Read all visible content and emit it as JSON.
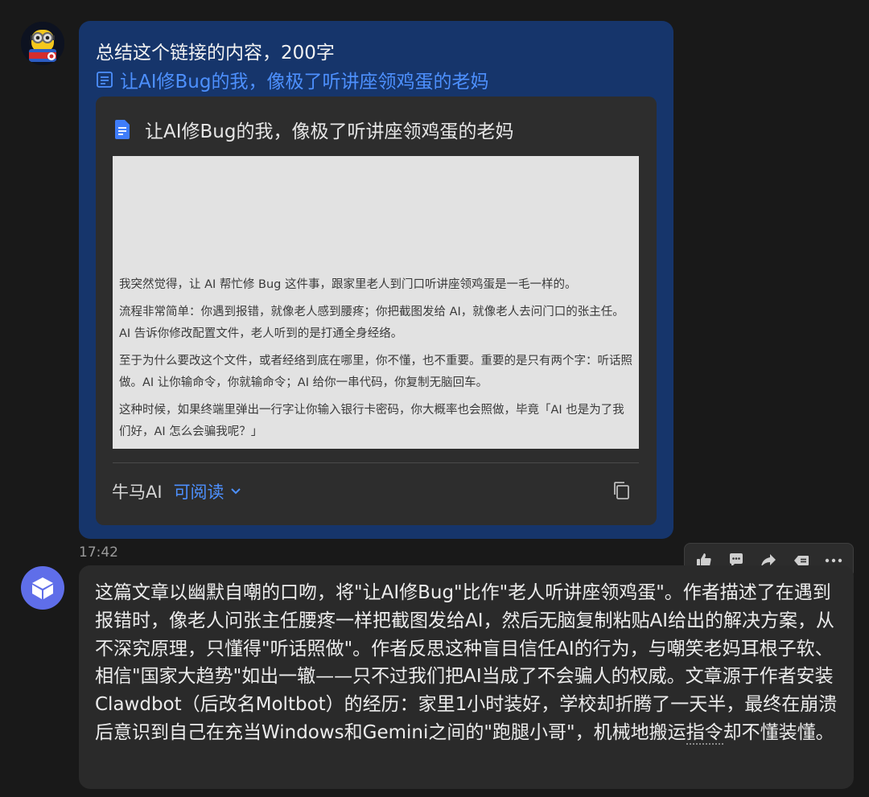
{
  "user_message": {
    "text": "总结这个链接的内容，200字",
    "link_text": "让AI修Bug的我，像极了听讲座领鸡蛋的老妈",
    "link_card": {
      "title": "让AI修Bug的我，像极了听讲座领鸡蛋的老妈",
      "preview_paragraphs": [
        "我突然觉得，让 AI 帮忙修 Bug 这件事，跟家里老人到门口听讲座领鸡蛋是一毛一样的。",
        "流程非常简单：你遇到报错，就像老人感到腰疼；你把截图发给 AI，就像老人去问门口的张主任。AI 告诉你修改配置文件，老人听到的是打通全身经络。",
        "至于为什么要改这个文件，或者经络到底在哪里，你不懂，也不重要。重要的是只有两个字：听话照做。AI 让你输命令，你就输命令；AI 给你一串代码，你复制无脑回车。",
        "这种时候，如果终端里弹出一行字让你输入银行卡密码，你大概率也会照做，毕竟「AI 也是为了我们好，AI 怎么会骗我呢？」"
      ],
      "source": "牛马AI",
      "readable_label": "可阅读",
      "doc_icon": "document-icon",
      "copy_icon": "copy-icon"
    },
    "timestamp": "17:42"
  },
  "toolbar": {
    "icons": [
      "thumbs-up-icon",
      "comment-icon",
      "share-icon",
      "quote-icon",
      "more-icon"
    ]
  },
  "ai_message": {
    "text_main": "这篇文章以幽默自嘲的口吻，将\"让AI修Bug\"比作\"老人听讲座领鸡蛋\"。作者描述了在遇到报错时，像老人问张主任腰疼一样把截图发给AI，然后无脑复制粘贴AI给出的解决方案，从不深究原理，只懂得\"听话照做\"。作者反思这种盲目信任AI的行为，与嘲笑老妈耳根子软、相信\"国家大趋势\"如出一辙——只不过我们把AI当成了不会骗人的权威。文章源于作者安装Clawdbot（后改名Moltbot）的经历：家里1小时装好，学校却折腾了一天半，最终在崩溃后意识到自己在充当Windows和Gemini之间的\"跑腿小哥\"，机械地搬运",
    "text_dotted": "指令",
    "text_end": "却不懂装懂。"
  },
  "colors": {
    "background": "#191919",
    "user_bubble": "#16356b",
    "card": "#2d2d2d",
    "link_blue": "#4d90fe",
    "ai_bubble": "#2a2a2a",
    "ai_avatar": "#5f6ee9"
  }
}
